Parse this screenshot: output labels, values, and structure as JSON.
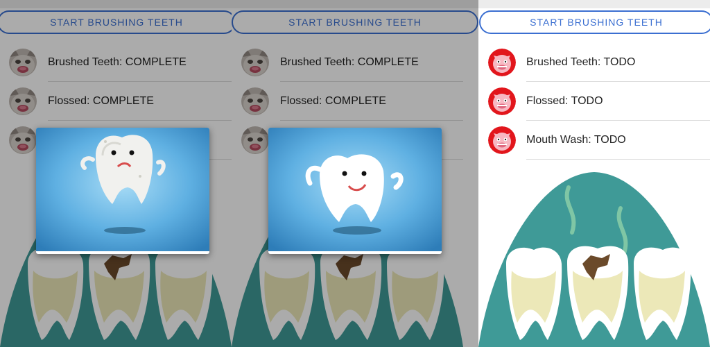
{
  "start_button_label": "START BRUSHING TEETH",
  "panels": [
    {
      "items": [
        {
          "label": "Brushed Teeth: COMPLETE",
          "avatar": "cat-avatar"
        },
        {
          "label": "Flossed: COMPLETE",
          "avatar": "cat-avatar"
        },
        {
          "label": "",
          "avatar": "cat-avatar"
        }
      ],
      "dialog": "sad-tooth-image"
    },
    {
      "items": [
        {
          "label": "Brushed Teeth: COMPLETE",
          "avatar": "cat-avatar"
        },
        {
          "label": "Flossed: COMPLETE",
          "avatar": "cat-avatar"
        },
        {
          "label": "",
          "avatar": "cat-avatar"
        }
      ],
      "dialog": "happy-tooth-image"
    },
    {
      "items": [
        {
          "label": "Brushed Teeth: TODO",
          "avatar": "pig-avatar"
        },
        {
          "label": "Flossed: TODO",
          "avatar": "pig-avatar"
        },
        {
          "label": "Mouth Wash: TODO",
          "avatar": "pig-avatar"
        }
      ]
    }
  ],
  "colors": {
    "accent": "#3b6fd1",
    "teal": "#3f9a97",
    "cream": "#ece8b8",
    "cavity": "#6b4a2a",
    "sky": "#4a9ad2",
    "pig_red": "#e2161c"
  }
}
